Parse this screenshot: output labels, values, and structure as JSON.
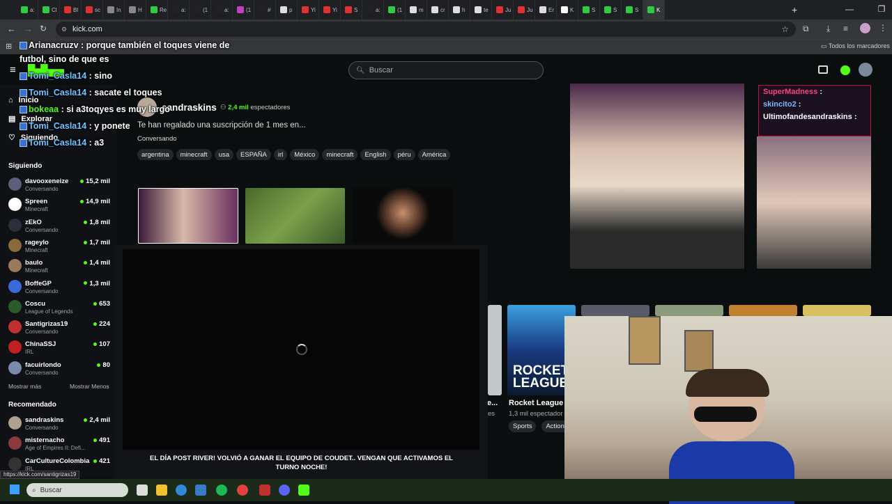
{
  "browser": {
    "tabs": [
      "a:",
      "Cl",
      "Bl",
      "sc",
      "In",
      "H",
      "Re",
      "a:",
      "(1",
      "a:",
      "(1",
      "#",
      "p",
      "Yi",
      "Yi",
      "S",
      "a:",
      "(1",
      "m",
      "cr",
      "h",
      "te",
      "Ju",
      "Ju",
      "Er",
      "K",
      "S",
      "S",
      "S",
      "K"
    ],
    "url": "kick.com",
    "bookmarks_label": "Todos los marcadores",
    "status_url": "https://kick.com/santigrizas19"
  },
  "kick": {
    "search_placeholder": "Buscar",
    "nav": {
      "inicio": "Inicio",
      "explorar": "Explorar",
      "siguiendo": "Siguiendo"
    },
    "following_header": "Siguiendo",
    "following": [
      {
        "name": "davooxeneize",
        "category": "Conversando",
        "viewers": "15,2 mil",
        "color": "#5a5f7a"
      },
      {
        "name": "Spreen",
        "category": "Minecraft",
        "viewers": "14,9 mil",
        "color": "#ffffff"
      },
      {
        "name": "zEkO",
        "category": "Conversando",
        "viewers": "1,8 mil",
        "color": "#2a2f3a"
      },
      {
        "name": "rageylo",
        "category": "Minecraft",
        "viewers": "1,7 mil",
        "color": "#8a6a3a"
      },
      {
        "name": "baulo",
        "category": "Minecraft",
        "viewers": "1,4 mil",
        "color": "#9a7a5a"
      },
      {
        "name": "BoffeGP",
        "category": "Conversando",
        "viewers": "1,3 mil",
        "color": "#3a6ad8"
      },
      {
        "name": "Coscu",
        "category": "League of Legends",
        "viewers": "653",
        "color": "#2a5a2a"
      },
      {
        "name": "Santigrizas19",
        "category": "Conversando",
        "viewers": "224",
        "color": "#c03030"
      },
      {
        "name": "ChinaSSJ",
        "category": "IRL",
        "viewers": "107",
        "color": "#c02020"
      },
      {
        "name": "facuirlondo",
        "category": "Conversando",
        "viewers": "80",
        "color": "#7a8aaa"
      }
    ],
    "show_more": "Mostrar más",
    "show_less": "Mostrar Menos",
    "recommended_header": "Recomendado",
    "recommended": [
      {
        "name": "sandraskins",
        "category": "Conversando",
        "viewers": "2,4 mil",
        "color": "#b0a090"
      },
      {
        "name": "misternacho",
        "category": "Age of Empires II: Defi...",
        "viewers": "491",
        "color": "#8a3a3a"
      },
      {
        "name": "CarCultureColombia",
        "category": "IRL",
        "viewers": "421",
        "color": "#333"
      }
    ],
    "featured": {
      "streamer": "sandraskins",
      "viewers": "2,4 mil",
      "viewers_label": "espectadores",
      "title": "Te han regalado una suscripción de 1 mes en...",
      "category": "Conversando",
      "tags": [
        "argentina",
        "minecraft",
        "usa",
        "ESPAÑA",
        "irl",
        "México",
        "minecraft",
        "English",
        "péru",
        "América"
      ]
    },
    "player_title": "EL DÍA POST RIVER! VOLVIÓ A GANAR EL EQUIPO DE COUDET.. VENGAN QUE ACTIVAMOS EL TURNO NOCHE!",
    "card": {
      "title": "Rocket League",
      "viewers": "1,3 mil espectador",
      "tags": [
        "Sports",
        "Action"
      ],
      "partial_title": "e...",
      "partial_sub": "es"
    },
    "rocket_logo": "ROCKET LEAGUE"
  },
  "stream_chat_inset": [
    {
      "user": "SuperMadness",
      "msg": ":"
    },
    {
      "user": "skincito2",
      "msg": ":"
    },
    {
      "user": "Ultimofandesandraskins",
      "msg": ":"
    }
  ],
  "overlay_chat": [
    {
      "user": "Arianacruzv",
      "msg": ": porque también el toques viene de",
      "color": "#ffffff"
    },
    {
      "user": "",
      "msg": "futbol, sino de que es",
      "color": "#ffffff"
    },
    {
      "user": "Tomi_Casla14",
      "msg": ": sino",
      "color": "#6ec6ff"
    },
    {
      "user": "Tomi_Casla14",
      "msg": ": sacate el toques",
      "color": "#6ec6ff"
    },
    {
      "user": "bokeaa",
      "msg": ": si a3toqyes es muy largo",
      "color": "#53fc18"
    },
    {
      "user": "Tomi_Casla14",
      "msg": ": y ponete",
      "color": "#6ec6ff"
    },
    {
      "user": "Tomi_Casla14",
      "msg": ": a3",
      "color": "#6ec6ff"
    }
  ],
  "taskbar": {
    "search": "Buscar"
  }
}
